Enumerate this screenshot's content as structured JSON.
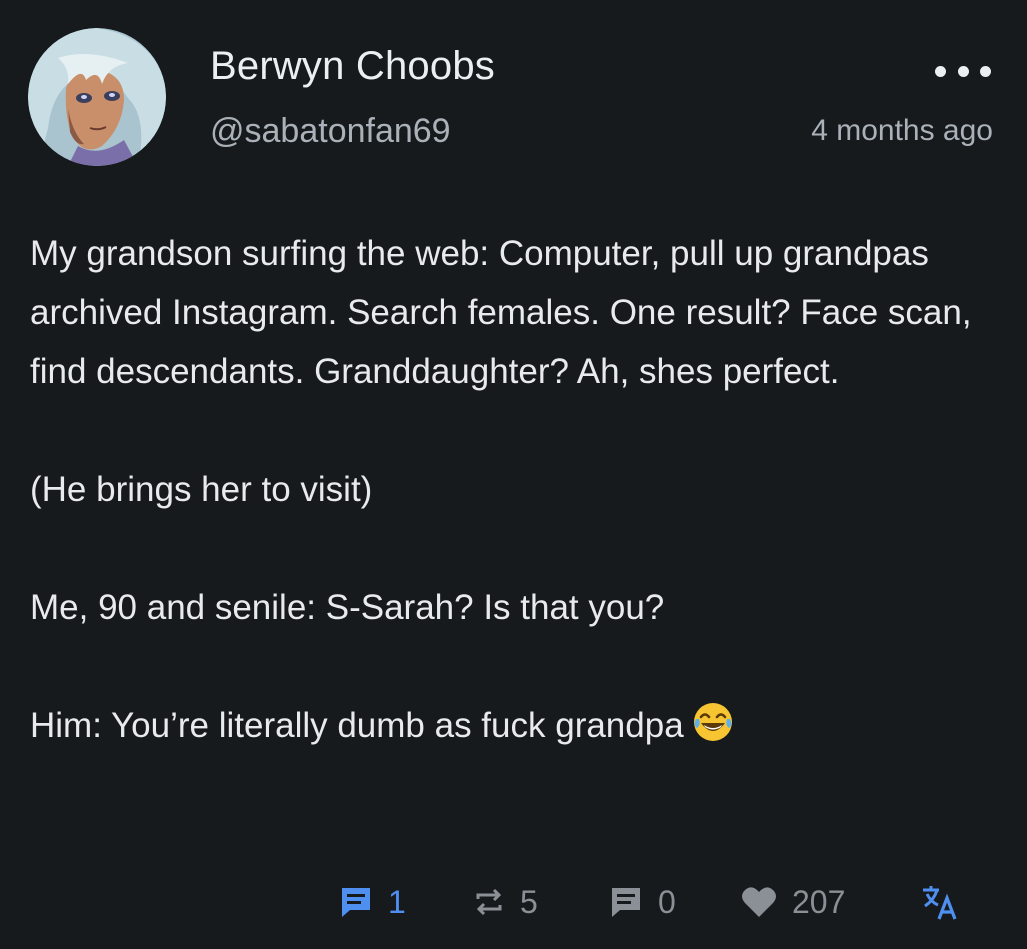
{
  "post": {
    "author": {
      "display_name": "Berwyn Choobs",
      "handle": "@sabatonfan69",
      "avatar_icon": "anime-character-avatar"
    },
    "timestamp": "4 months ago",
    "more_icon": "more-horizontal-icon",
    "body": {
      "paragraph_1": "My grandson surfing the web: Computer, pull up grandpas archived Instagram. Search females. One result? Face scan, find descendants. Granddaughter? Ah, shes perfect.",
      "paragraph_2": "(He brings her to visit)",
      "paragraph_3": "Me, 90 and senile: S-Sarah? Is that you?",
      "paragraph_4": "Him: You’re literally dumb as fuck grandpa",
      "emoji": "face-with-tears-of-joy"
    },
    "actions": {
      "replies": "1",
      "boosts": "5",
      "quotes": "0",
      "likes": "207",
      "reply_icon": "comment-icon",
      "boost_icon": "repeat-icon",
      "quote_icon": "message-icon",
      "like_icon": "heart-icon",
      "translate_icon": "translate-icon"
    }
  },
  "colors": {
    "background": "#161a1d",
    "text_primary": "#e8eaec",
    "text_secondary": "#aab1b8",
    "accent": "#4e8ff0",
    "muted_icon": "#8a9096"
  }
}
